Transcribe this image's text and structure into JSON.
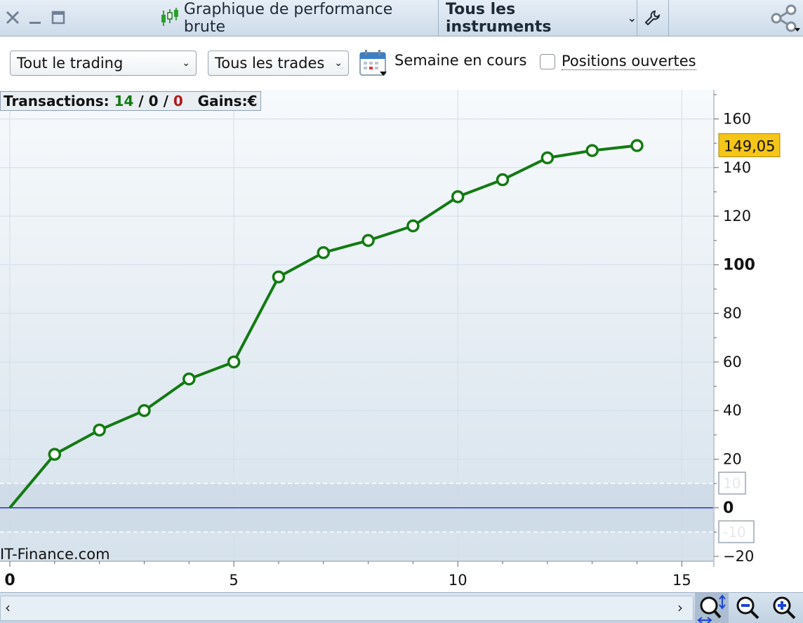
{
  "window": {
    "title": "Graphique de performance brute",
    "instrument_menu": "Tous les instruments"
  },
  "toolbar": {
    "trading_select": "Tout le trading",
    "trades_select": "Tous les trades",
    "period": "Semaine en cours",
    "open_positions_label": "Positions ouvertes",
    "open_positions_checked": false
  },
  "stats": {
    "label": "Transactions:",
    "wins": "14",
    "sep1": "/",
    "neutral": "0",
    "sep2": "/",
    "losses": "0",
    "gains_label": "Gains:",
    "currency": "€"
  },
  "watermark": "IT-Finance.com",
  "chart_data": {
    "type": "line",
    "x": [
      0,
      1,
      2,
      3,
      4,
      5,
      6,
      7,
      8,
      9,
      10,
      11,
      12,
      13,
      14
    ],
    "series": [
      {
        "values": [
          0,
          22,
          32,
          40,
          53,
          60,
          95,
          105,
          110,
          116,
          128,
          135,
          144,
          147,
          149.05
        ]
      }
    ],
    "xlim": [
      0,
      15.7
    ],
    "ylim": [
      -22,
      172
    ],
    "x_ticks": [
      0,
      5,
      10,
      15
    ],
    "y_ticks": [
      -20,
      0,
      20,
      40,
      60,
      80,
      100,
      120,
      140,
      160
    ],
    "y_bold_ticks": [
      0,
      100
    ],
    "y_tick_labels": [
      "−20",
      "0",
      "20",
      "40",
      "60",
      "80",
      "100",
      "120",
      "140",
      "160"
    ],
    "band": {
      "upper": 10,
      "lower": -10,
      "upper_label": "10",
      "lower_label": "-10"
    },
    "last_value_label": "149,05",
    "grid": true,
    "colors": {
      "line": "#137a13",
      "zero_line": "#2233cc",
      "last_badge": "#f5c518"
    }
  }
}
